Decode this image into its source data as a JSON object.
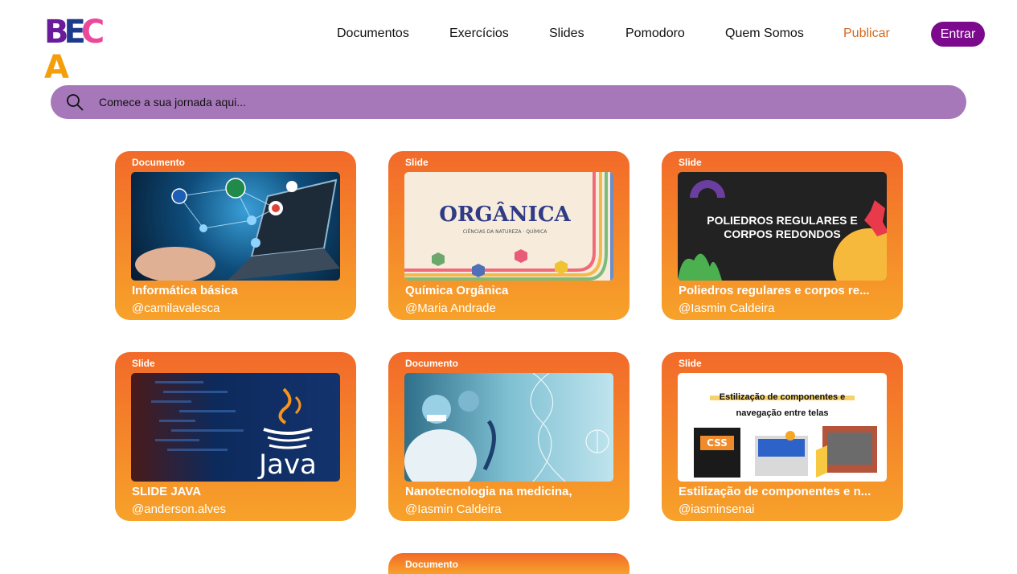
{
  "header": {
    "logo_text": "BECA",
    "nav": [
      {
        "label": "Documentos"
      },
      {
        "label": "Exercícios"
      },
      {
        "label": "Slides"
      },
      {
        "label": "Pomodoro"
      },
      {
        "label": "Quem Somos"
      },
      {
        "label": "Publicar"
      }
    ],
    "login_label": "Entrar"
  },
  "search": {
    "placeholder": "Comece a sua jornada aqui..."
  },
  "cards": [
    {
      "type": "Documento",
      "title": "Informática básica",
      "author": "@camilavalesca",
      "thumb_icon": "laptop-network-icon"
    },
    {
      "type": "Slide",
      "title": "Química Orgânica",
      "author": "@Maria Andrade",
      "thumb_text": "ORGÂNICA",
      "thumb_subtext": "CIÊNCIAS DA NATUREZA · QUÍMICA"
    },
    {
      "type": "Slide",
      "title": "Poliedros regulares e corpos re...",
      "author": "@Iasmin Caldeira",
      "thumb_text": "POLIEDROS REGULARES E CORPOS REDONDOS"
    },
    {
      "type": "Slide",
      "title": "SLIDE JAVA",
      "author": "@anderson.alves",
      "thumb_text": "Java"
    },
    {
      "type": "Documento",
      "title": "Nanotecnologia na medicina,",
      "author": "@Iasmin Caldeira",
      "thumb_icon": "lab-scientists-icon"
    },
    {
      "type": "Slide",
      "title": "Estilização de componentes e n...",
      "author": "@iasminsenai",
      "thumb_text": "Estilização de componentes e navegação entre telas",
      "thumb_badge": "CSS"
    },
    {
      "type": "Documento"
    }
  ],
  "colors": {
    "brand_purple": "#7b0a8c",
    "search_bg": "#a678b9",
    "card_top": "#f26a2a",
    "card_bottom": "#f7a22a",
    "publish_link": "#d2691e"
  }
}
